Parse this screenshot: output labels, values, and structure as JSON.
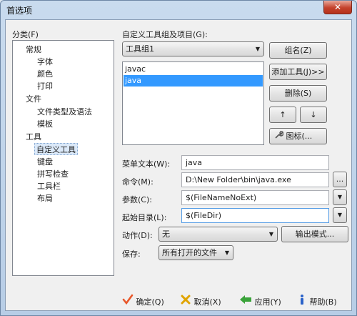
{
  "window": {
    "title": "首选项",
    "close_glyph": "✕"
  },
  "category": {
    "label": "分类(F)",
    "items": [
      {
        "label": "常规"
      },
      {
        "label": "字体"
      },
      {
        "label": "颜色"
      },
      {
        "label": "打印"
      },
      {
        "label": "文件"
      },
      {
        "label": "文件类型及语法"
      },
      {
        "label": "模板"
      },
      {
        "label": "工具"
      },
      {
        "label": "自定义工具"
      },
      {
        "label": "键盘"
      },
      {
        "label": "拼写检查"
      },
      {
        "label": "工具栏"
      },
      {
        "label": "布局"
      }
    ]
  },
  "groups": {
    "label": "自定义工具组及项目(G):",
    "selected_group": "工具组1",
    "items": [
      "javac",
      "java"
    ]
  },
  "buttons": {
    "group_name": "组名(Z)",
    "add_tool": "添加工具(J)>>",
    "delete": "删除(S)",
    "move_up": "↑",
    "move_down": "↓",
    "icon": "图标(...",
    "browse": "...",
    "output_mode": "输出模式..."
  },
  "fields": {
    "menu_text": {
      "label": "菜单文本(W):",
      "value": "java"
    },
    "command": {
      "label": "命令(M):",
      "value": "D:\\New Folder\\bin\\java.exe"
    },
    "params": {
      "label": "参数(C):",
      "value": "$(FileNameNoExt)"
    },
    "start_dir": {
      "label": "起始目录(L):",
      "value": "$(FileDir)"
    },
    "action": {
      "label": "动作(D):",
      "value": "无"
    },
    "save": {
      "label": "保存:",
      "value": "所有打开的文件"
    }
  },
  "footer": {
    "ok": "确定(Q)",
    "cancel": "取消(X)",
    "apply": "应用(Y)",
    "help": "帮助(B)"
  },
  "colors": {
    "selection": "#3399ff",
    "ok_check": "#e8572a",
    "cancel_x": "#e0a400",
    "apply_arrow": "#3aa33a",
    "help_icon": "#2a62c9"
  }
}
